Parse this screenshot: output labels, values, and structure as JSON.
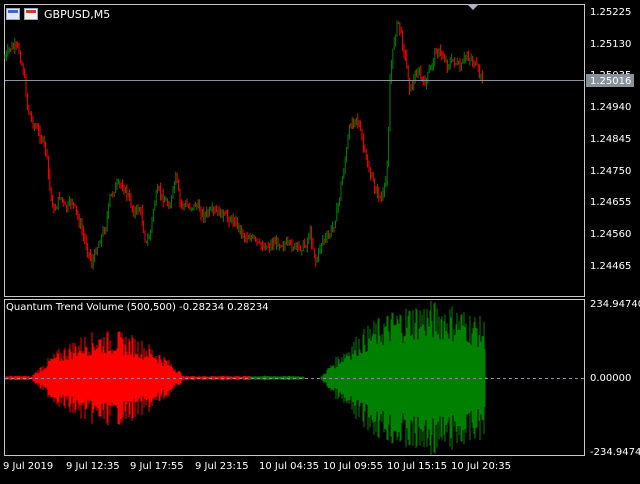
{
  "chart": {
    "symbol": "GBPUSD,M5",
    "colors": {
      "background": "#000000",
      "frame": "#c8c8c8",
      "bull": "#008000",
      "bear": "#ff0000",
      "text": "#ffffff",
      "current_line": "#8a9099",
      "current_label_bg": "#8a9099"
    },
    "current_price_label": "1.25016",
    "price_axis": {
      "labels": [
        "1.25225",
        "1.25130",
        "1.25035",
        "1.24940",
        "1.24845",
        "1.24750",
        "1.24655",
        "1.24560",
        "1.24465"
      ],
      "values": [
        1.25225,
        1.2513,
        1.25035,
        1.2494,
        1.24845,
        1.2475,
        1.24655,
        1.2456,
        1.24465
      ]
    },
    "time_axis": {
      "labels": [
        "9 Jul 2019",
        "9 Jul 12:35",
        "9 Jul 17:55",
        "9 Jul 23:15",
        "10 Jul 04:35",
        "10 Jul 09:55",
        "10 Jul 15:15",
        "10 Jul 20:35"
      ]
    }
  },
  "indicator": {
    "label": "Quantum Trend Volume (500,500) -0.28234 0.28234",
    "axis_labels": [
      "234.94740",
      "0.00000",
      "-234.94740"
    ],
    "axis_values": [
      234.9474,
      0,
      -234.9474
    ]
  },
  "icons": [
    "chart-window-icon",
    "chart-window-icon-2",
    "scroll-marker-icon"
  ]
}
